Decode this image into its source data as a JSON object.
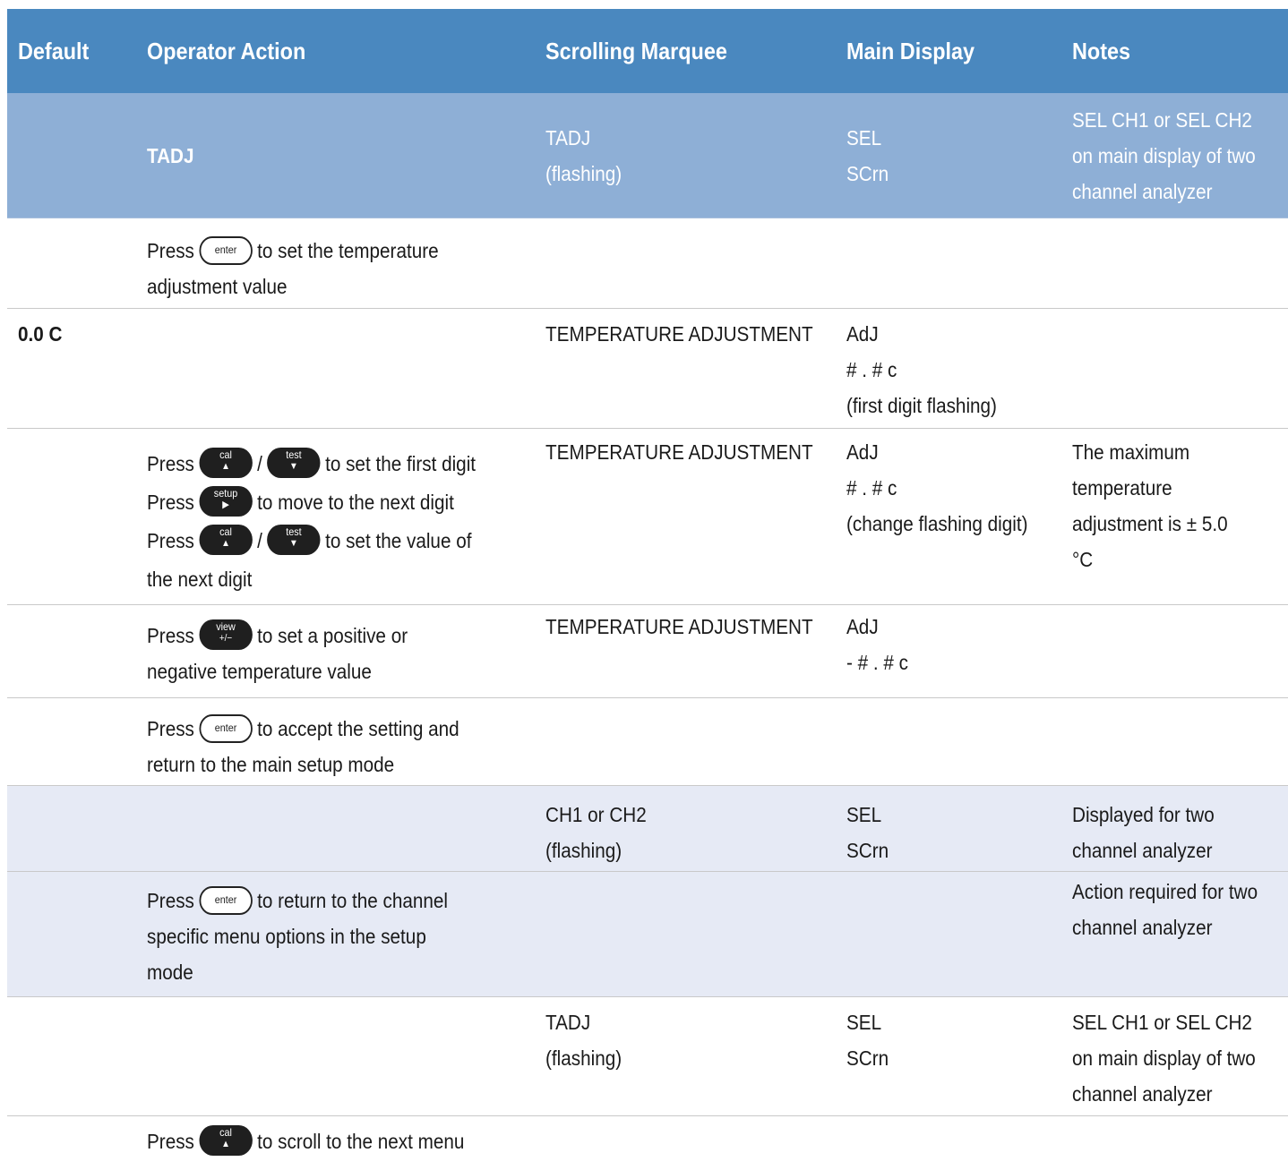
{
  "header": {
    "default": "Default",
    "operator_action": "Operator Action",
    "scrolling_marquee": "Scrolling Marquee",
    "main_display": "Main Display",
    "notes": "Notes"
  },
  "rows": [
    {
      "operator": "TADJ",
      "marquee": [
        "TADJ",
        "(flashing)"
      ],
      "main": [
        "SEL",
        "SCrn"
      ],
      "notes": [
        "SEL CH1 or SEL CH2",
        "on main display of two",
        "channel analyzer"
      ]
    },
    {
      "op_prefix": "Press",
      "op_key": "enter",
      "op_after": "to set the temperature",
      "op_line2": "adjustment value"
    },
    {
      "default": "0.0 C",
      "marquee": [
        "TEMPERATURE ADJUSTMENT"
      ],
      "main": [
        "AdJ",
        "# . # c",
        "(first digit flashing)"
      ]
    },
    {
      "l1_prefix": "Press",
      "l1_key1": "cal",
      "l1_key1_arrow": "▲",
      "l1_sep": "/",
      "l1_key2": "test",
      "l1_key2_arrow": "▼",
      "l1_after": "to set the first digit",
      "l2_prefix": "Press",
      "l2_key": "setup",
      "l2_key_arrow": "▶",
      "l2_after": "to move to the next digit",
      "l3_prefix": "Press",
      "l3_key1": "cal",
      "l3_key1_arrow": "▲",
      "l3_sep": "/",
      "l3_key2": "test",
      "l3_key2_arrow": "▼",
      "l3_after": "to set the value of",
      "l4": "the next digit",
      "marquee": [
        "TEMPERATURE ADJUSTMENT"
      ],
      "main": [
        "AdJ",
        "# . # c",
        "(change flashing digit)"
      ],
      "notes": [
        "The maximum",
        "temperature",
        "adjustment is ± 5.0",
        "°C"
      ]
    },
    {
      "op_prefix": "Press",
      "op_key": "view",
      "op_key_sub": "+/−",
      "op_after": "to set a positive or",
      "op_line2": "negative temperature value",
      "marquee": [
        "TEMPERATURE ADJUSTMENT"
      ],
      "main": [
        "AdJ",
        "- # . # c"
      ]
    },
    {
      "op_prefix": "Press",
      "op_key": "enter",
      "op_after": "to accept the setting and",
      "op_line2": "return to the main setup mode"
    },
    {
      "marquee": [
        "CH1 or CH2",
        "(flashing)"
      ],
      "main": [
        "SEL",
        "SCrn"
      ],
      "notes": [
        "Displayed for two",
        "channel analyzer"
      ]
    },
    {
      "op_prefix": "Press",
      "op_key": "enter",
      "op_after": "to return to the channel",
      "op_line2": "specific menu options in the setup",
      "op_line3": "mode",
      "notes": [
        "Action required for two",
        "channel analyzer"
      ]
    },
    {
      "marquee": [
        "TADJ",
        "(flashing)"
      ],
      "main": [
        "SEL",
        "SCrn"
      ],
      "notes": [
        "SEL CH1 or SEL CH2",
        "on main display of two",
        "channel analyzer"
      ]
    },
    {
      "op_prefix": "Press",
      "op_key": "cal",
      "op_key_arrow": "▲",
      "op_after": "to scroll to the next menu"
    }
  ]
}
